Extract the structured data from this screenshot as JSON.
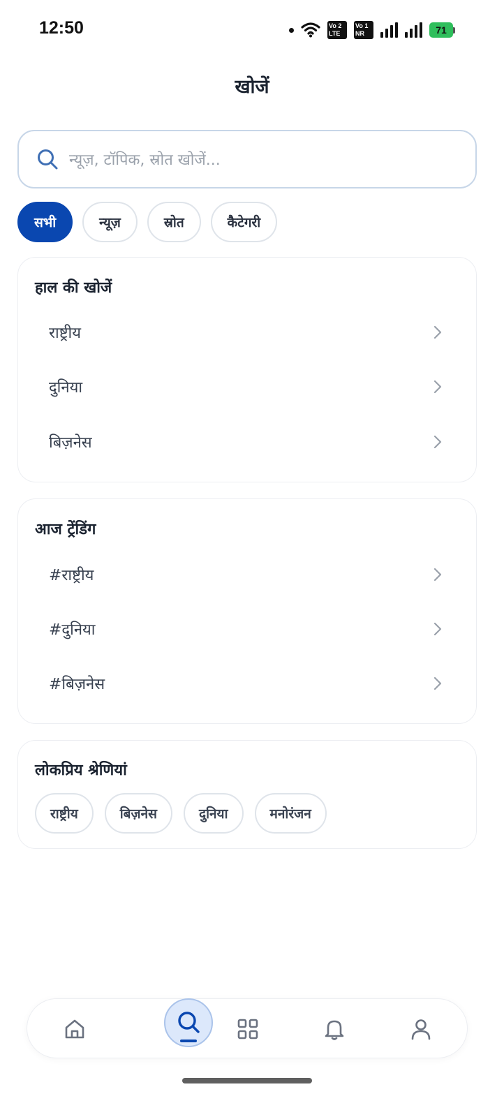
{
  "status_bar": {
    "time": "12:50",
    "sim1_label": "Vo 2 LTE",
    "sim2_label": "Vo 1 NR",
    "battery": "71",
    "icons": [
      "dot-icon",
      "wifi-icon",
      "sim-icon",
      "signal-icon",
      "battery-charging-icon"
    ]
  },
  "header": {
    "title": "खोजें"
  },
  "search": {
    "placeholder": "न्यूज़, टॉपिक, स्रोत खोजें..."
  },
  "filters": [
    {
      "label": "सभी",
      "active": true
    },
    {
      "label": "न्यूज़",
      "active": false
    },
    {
      "label": "स्रोत",
      "active": false
    },
    {
      "label": "कैटेगरी",
      "active": false
    }
  ],
  "recent": {
    "title": "हाल की खोजें",
    "items": [
      "राष्ट्रीय",
      "दुनिया",
      "बिज़नेस"
    ]
  },
  "trending": {
    "title": "आज ट्रेंडिंग",
    "items": [
      "#राष्ट्रीय",
      "#दुनिया",
      "#बिज़नेस"
    ]
  },
  "popular": {
    "title": "लोकप्रिय श्रेणियां",
    "items": [
      "राष्ट्रीय",
      "बिज़नेस",
      "दुनिया",
      "मनोरंजन"
    ]
  },
  "bottom_nav": {
    "items": [
      "home-icon",
      "search-icon",
      "grid-icon",
      "bell-icon",
      "user-icon"
    ],
    "active": "search-icon"
  },
  "colors": {
    "accent": "#0a47b0",
    "active_circle": "#dce8fb",
    "battery": "#2fbe5c"
  }
}
